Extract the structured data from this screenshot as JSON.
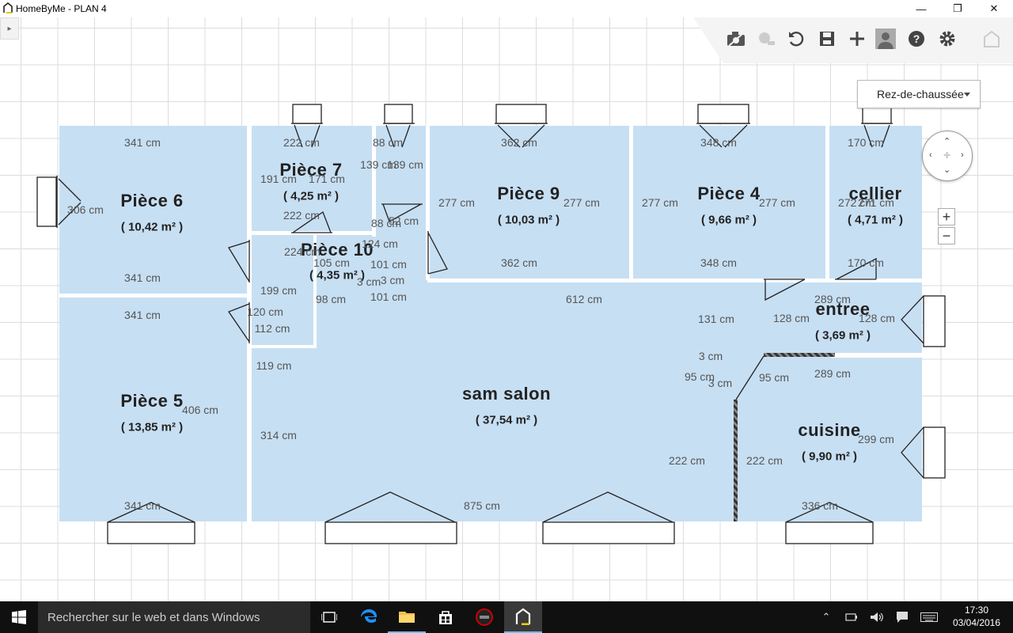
{
  "window": {
    "title": "HomeByMe - PLAN 4",
    "minimize": "—",
    "maximize": "❐",
    "close": "✕"
  },
  "toolbar": {
    "icons": [
      "camera-icon",
      "search-3d-icon",
      "undo-icon",
      "save-icon",
      "add-icon",
      "user-icon",
      "help-icon",
      "settings-icon",
      "home-icon"
    ]
  },
  "level_selector": {
    "value": "Rez-de-chaussée"
  },
  "zoom": {
    "in": "+",
    "out": "−"
  },
  "rooms": [
    {
      "name": "Pièce 6",
      "area": "( 10,42 m² )"
    },
    {
      "name": "Pièce 7",
      "area": "( 4,25 m² )"
    },
    {
      "name": "Pièce 10",
      "area": "( 4,35 m² )"
    },
    {
      "name": "Pièce 9",
      "area": "( 10,03 m² )"
    },
    {
      "name": "Pièce 4",
      "area": "( 9,66 m² )"
    },
    {
      "name": "cellier",
      "area": "( 4,71 m² )"
    },
    {
      "name": "entree",
      "area": "( 3,69 m² )"
    },
    {
      "name": "Pièce 5",
      "area": "( 13,85 m² )"
    },
    {
      "name": "sam salon",
      "area": "( 37,54 m² )"
    },
    {
      "name": "cuisine",
      "area": "( 9,90 m² )"
    }
  ],
  "dimensions": [
    "341 cm",
    "222 cm",
    "88 cm",
    "362 cm",
    "348 cm",
    "170 cm",
    "306 cm",
    "191 cm",
    "171 cm",
    "139 cm",
    "139 cm",
    "277 cm",
    "277 cm",
    "277 cm",
    "277 cm",
    "272 cm",
    "271 cm",
    "222 cm",
    "88 cm",
    "52 cm",
    "224 cm",
    "124 cm",
    "105 cm",
    "101 cm",
    "3 cm",
    "3 cm",
    "362 cm",
    "348 cm",
    "170 cm",
    "341 cm",
    "199 cm",
    "98 cm",
    "101 cm",
    "612 cm",
    "289 cm",
    "341 cm",
    "120 cm",
    "112 cm",
    "131 cm",
    "128 cm",
    "128 cm",
    "3 cm",
    "119 cm",
    "95 cm",
    "3 cm",
    "95 cm",
    "289 cm",
    "406 cm",
    "314 cm",
    "299 cm",
    "222 cm",
    "222 cm",
    "341 cm",
    "875 cm",
    "336 cm"
  ],
  "taskbar": {
    "search_placeholder": "Rechercher sur le web et dans Windows",
    "time": "17:30",
    "date": "03/04/2016"
  }
}
